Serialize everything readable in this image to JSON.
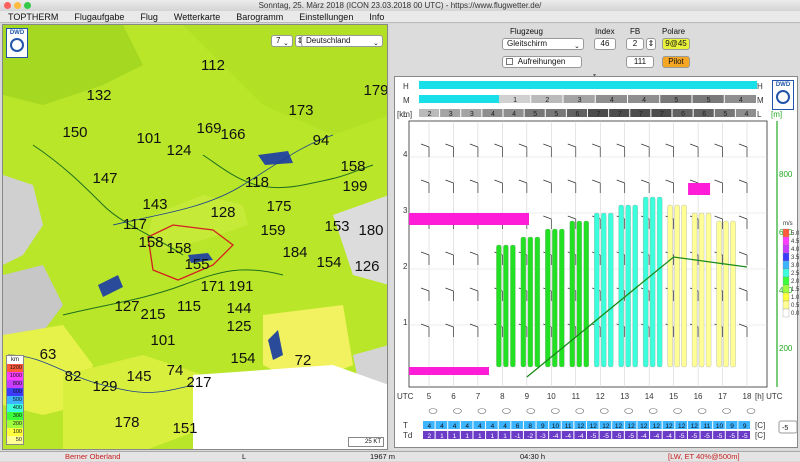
{
  "title": "Sonntag, 25. März 2018 (ICON 23.03.2018 00 UTC) - https://www.flugwetter.de/",
  "menu": [
    "TOPTHERM",
    "Flugaufgabe",
    "Flug",
    "Wetterkarte",
    "Barogramm",
    "Einstellungen",
    "Info"
  ],
  "map": {
    "hour_value": "7",
    "region": "Deutschland",
    "scale": "25 KT",
    "legend_unit": "km",
    "legend_labels": [
      "1200",
      "1000",
      "800",
      "600",
      "500",
      "400",
      "300",
      "200",
      "100",
      "50"
    ],
    "legend_colors": [
      "#ff5a3c",
      "#ff3cff",
      "#c83cff",
      "#3c3cff",
      "#3cb4ff",
      "#3cffdc",
      "#3cff3c",
      "#a0ff3c",
      "#ffff3c",
      "#ffff96"
    ],
    "values": [
      "112",
      "132",
      "179",
      "169",
      "166",
      "173",
      "150",
      "101",
      "124",
      "94",
      "147",
      "158",
      "199",
      "118",
      "143",
      "175",
      "128",
      "180",
      "117",
      "158",
      "159",
      "153",
      "158",
      "184",
      "154",
      "155",
      "126",
      "127",
      "215",
      "115",
      "171",
      "191",
      "144",
      "125",
      "63",
      "101",
      "82",
      "129",
      "145",
      "74",
      "217",
      "72",
      "154",
      "178",
      "151"
    ]
  },
  "panel": {
    "flugzeug_label": "Flugzeug",
    "flugzeug_value": "Gleitschirm",
    "index_label": "Index",
    "index_value": "46",
    "fb_label": "FB",
    "fb_value": "2",
    "polare_label": "Polare",
    "polare_value": "9@45",
    "aufreihungen_label": "Aufreihungen",
    "field_111": "111",
    "pilot_label": "Pilot"
  },
  "chart": {
    "cloud_labels": [
      "H",
      "M",
      "L"
    ],
    "mid_cloud_values": [
      "1",
      "2",
      "3",
      "4",
      "4",
      "5",
      "5",
      "4"
    ],
    "low_cloud_values": [
      "2",
      "3",
      "3",
      "4",
      "4",
      "5",
      "5",
      "6",
      "7",
      "7",
      "7",
      "7",
      "6",
      "6",
      "5",
      "4"
    ],
    "km_unit": "[km]",
    "m_unit": "[m]",
    "km_ticks": [
      "4",
      "3",
      "2",
      "1"
    ],
    "m_ticks": [
      "800",
      "600",
      "400",
      "200"
    ],
    "hours": [
      "5",
      "6",
      "7",
      "8",
      "9",
      "10",
      "11",
      "12",
      "13",
      "14",
      "15",
      "16",
      "17",
      "18"
    ],
    "utc_label": "UTC",
    "h_utc_label": "[h] UTC",
    "ms_unit": "m/s",
    "ms_scale": [
      "5.0",
      "4.5",
      "4.0",
      "3.5",
      "3.0",
      "2.5",
      "2.0",
      "1.5",
      "1.0",
      "0.5",
      "0.0"
    ],
    "ms_colors": [
      "#ff5a3c",
      "#ff3cff",
      "#c83cff",
      "#3c3cff",
      "#3cb4ff",
      "#3cffdc",
      "#3cff3c",
      "#a0ff3c",
      "#ffff3c",
      "#ffff96",
      "#ffffff"
    ],
    "t_label": "T",
    "td_label": "Td",
    "c_unit": "[C]",
    "t_values": [
      "4",
      "4",
      "4",
      "4",
      "4",
      "4",
      "4",
      "6",
      "8",
      "9",
      "10",
      "11",
      "12",
      "12",
      "12",
      "12",
      "12",
      "12",
      "12",
      "12",
      "12",
      "12",
      "11",
      "10",
      "9",
      "9"
    ],
    "td_values": [
      "2",
      "1",
      "1",
      "1",
      "1",
      "1",
      "1",
      "-1",
      "-2",
      "-3",
      "-4",
      "-4",
      "-4",
      "-5",
      "-5",
      "-5",
      "-5",
      "-4",
      "-4",
      "-4",
      "-5",
      "-5",
      "-5",
      "-5",
      "-5",
      "-5"
    ],
    "side_select": "-5"
  },
  "status": {
    "region": "Berner Oberland",
    "letter": "L",
    "altitude": "1967 m",
    "time": "04:30 h",
    "info": "[LW, ET  40%@500m]"
  }
}
